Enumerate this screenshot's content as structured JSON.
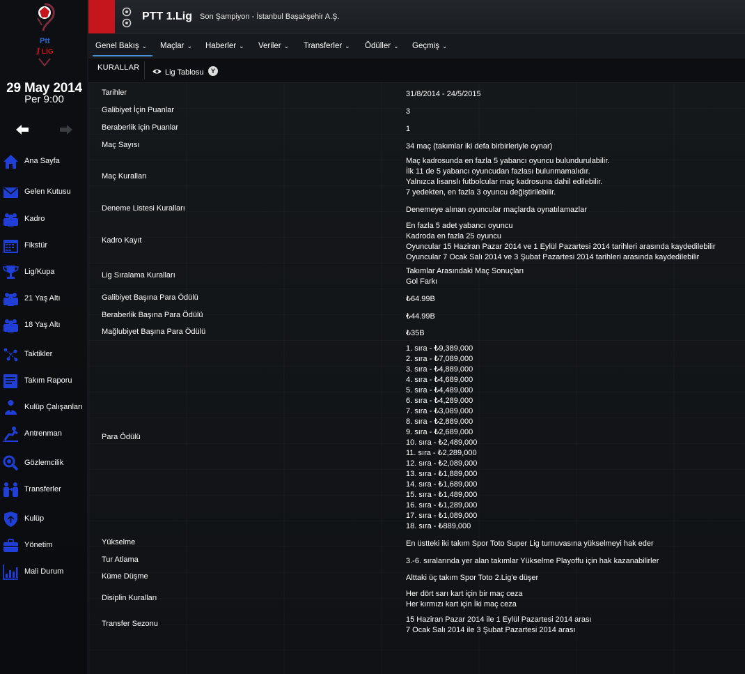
{
  "sidebar": {
    "date": "29 May 2014",
    "time": "Per 9:00",
    "items": [
      {
        "label": "Ana Sayfa",
        "icon": "home-icon"
      },
      {
        "label": "Gelen Kutusu",
        "icon": "inbox-icon"
      },
      {
        "label": "Kadro",
        "icon": "squad-icon"
      },
      {
        "label": "Fikstür",
        "icon": "calendar-icon"
      },
      {
        "label": "Lig/Kupa",
        "icon": "trophy-icon"
      },
      {
        "label": "21 Yaş Altı",
        "icon": "u21-squad-icon"
      },
      {
        "label": "18 Yaş Altı",
        "icon": "u18-squad-icon"
      },
      {
        "label": "Taktikler",
        "icon": "tactics-icon"
      },
      {
        "label": "Takım Raporu",
        "icon": "report-icon"
      },
      {
        "label": "Kulüp Çalışanları",
        "icon": "staff-icon"
      },
      {
        "label": "Antrenman",
        "icon": "training-icon"
      },
      {
        "label": "Gözlemcilik",
        "icon": "scouting-icon"
      },
      {
        "label": "Transferler",
        "icon": "transfers-icon"
      },
      {
        "label": "Kulüp",
        "icon": "club-icon"
      },
      {
        "label": "Yönetim",
        "icon": "board-icon"
      },
      {
        "label": "Mali Durum",
        "icon": "finances-icon"
      }
    ]
  },
  "logo": {
    "ptt": "Ptt",
    "lig": "LİG",
    "num": "1"
  },
  "header": {
    "title": "PTT 1.Lig",
    "subtitle": "Son Şampiyon - İstanbul Başakşehir A.Ş."
  },
  "menu": [
    {
      "label": "Genel Bakış"
    },
    {
      "label": "Maçlar"
    },
    {
      "label": "Haberler"
    },
    {
      "label": "Veriler"
    },
    {
      "label": "Transferler"
    },
    {
      "label": "Ödüller"
    },
    {
      "label": "Geçmiş"
    }
  ],
  "subtabs": {
    "rules": "KURALLAR",
    "table": "Lig Tablosu",
    "y_badge": "Y"
  },
  "rules": [
    {
      "label": "Tarihler",
      "lines": [
        "31/8/2014 - 24/5/2015"
      ]
    },
    {
      "label": "Galibiyet İçin Puanlar",
      "lines": [
        "3"
      ]
    },
    {
      "label": "Beraberlik için Puanlar",
      "lines": [
        "1"
      ]
    },
    {
      "label": "Maç Sayısı",
      "lines": [
        "34 maç (takımlar iki defa birbirleriyle oynar)"
      ]
    },
    {
      "label": "Maç Kuralları",
      "lines": [
        "Maç kadrosunda en fazla 5 yabancı oyuncu bulundurulabilir.",
        "İlk 11 de 5 yabancı oyuncudan fazlası bulunmamalıdır.",
        "Yalnızca lisanslı futbolcular maç kadrosuna dahil edilebilir.",
        "7 yedekten, en fazla 3 oyuncu değiştirilebilir."
      ]
    },
    {
      "label": "Deneme Listesi Kuralları",
      "lines": [
        "Denemeye alınan oyuncular maçlarda oynatılamazlar"
      ]
    },
    {
      "label": "Kadro Kayıt",
      "lines": [
        "En fazla 5 adet yabancı oyuncu",
        "Kadroda en fazla 25 oyuncu",
        "Oyuncular 15 Haziran Pazar 2014 ve 1 Eylül Pazartesi 2014 tarihleri arasında kaydedilebilir",
        "Oyuncular 7 Ocak Salı 2014 ve 3 Şubat Pazartesi 2014 tarihleri arasında kaydedilebilir"
      ]
    },
    {
      "label": "Lig Sıralama Kuralları",
      "lines": [
        "Takımlar Arasındaki Maç Sonuçları",
        "Gol Farkı"
      ]
    },
    {
      "label": "Galibiyet Başına Para Ödülü",
      "lines": [
        "₺64.99B"
      ]
    },
    {
      "label": "Beraberlik Başına Para Ödülü",
      "lines": [
        "₺44.99B"
      ]
    },
    {
      "label": "Mağlubiyet Başına Para Ödülü",
      "lines": [
        "₺35B"
      ]
    },
    {
      "label": "Para Ödülü",
      "lines": [
        "1. sıra - ₺9,389,000",
        "2. sıra - ₺7,089,000",
        "3. sıra - ₺4,889,000",
        "4. sıra - ₺4,689,000",
        "5. sıra - ₺4,489,000",
        "6. sıra - ₺4,289,000",
        "7. sıra - ₺3,089,000",
        "8. sıra - ₺2,889,000",
        "9. sıra - ₺2,689,000",
        "10. sıra - ₺2,489,000",
        "11. sıra - ₺2,289,000",
        "12. sıra - ₺2,089,000",
        "13. sıra - ₺1,889,000",
        "14. sıra - ₺1,689,000",
        "15. sıra - ₺1,489,000",
        "16. sıra - ₺1,289,000",
        "17. sıra - ₺1,089,000",
        "18. sıra - ₺889,000"
      ]
    },
    {
      "label": "Yükselme",
      "lines": [
        "En üstteki iki takım Spor Toto Super Lig turnuvasına yükselmeyi hak eder"
      ]
    },
    {
      "label": "Tur Atlama",
      "lines": [
        "3.-6. sıralarında yer alan takımlar Yükselme Playoffu için hak kazanabilirler"
      ]
    },
    {
      "label": "Küme Düşme",
      "lines": [
        "Alttaki üç takım Spor Toto 2.Lig'e düşer"
      ]
    },
    {
      "label": "Disiplin Kuralları",
      "lines": [
        "Her dört sarı kart için bir maç ceza",
        "Her kırmızı kart için İki maç ceza"
      ]
    },
    {
      "label": "Transfer Sezonu",
      "lines": [
        "15 Haziran Pazar 2014 ile 1 Eylül Pazartesi 2014 arası",
        "7 Ocak Salı 2014 ile 3 Şubat Pazartesi 2014 arası"
      ]
    }
  ],
  "colors": {
    "accent": "#c4161c",
    "icon_blue": "#1f3fd6",
    "tab_underline": "#4a8fd6"
  }
}
